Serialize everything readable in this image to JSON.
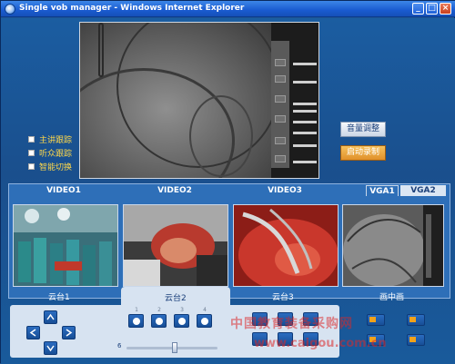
{
  "window": {
    "title": "Single vob manager - Windows Internet Explorer",
    "buttons": {
      "minimize": "_",
      "maximize": "□",
      "close": "×"
    }
  },
  "options": [
    {
      "label": "主讲跟踪",
      "checked": false
    },
    {
      "label": "听众跟踪",
      "checked": false
    },
    {
      "label": "智能切换",
      "checked": false
    }
  ],
  "buttons": {
    "volume": "音量调整",
    "record": "启动录制"
  },
  "videos": [
    {
      "label": "VIDEO1"
    },
    {
      "label": "VIDEO2"
    },
    {
      "label": "VIDEO3"
    }
  ],
  "vga_tabs": [
    {
      "label": "VGA1",
      "active": true
    },
    {
      "label": "VGA2",
      "active": false
    }
  ],
  "ptz": {
    "tabs": [
      "云台1",
      "云台2",
      "云台3",
      "画中画"
    ],
    "active_tab": "云台2",
    "presets": [
      "1",
      "2",
      "3",
      "4"
    ],
    "speed_value": "6",
    "speed_level": 0.55
  },
  "watermark": {
    "line1": "中国教育装备采购网",
    "line2": "www.caigou.com.cn"
  },
  "colors": {
    "background": "#1b5da1",
    "label_text": "#ffd84a",
    "record_button": "#e0902a"
  }
}
